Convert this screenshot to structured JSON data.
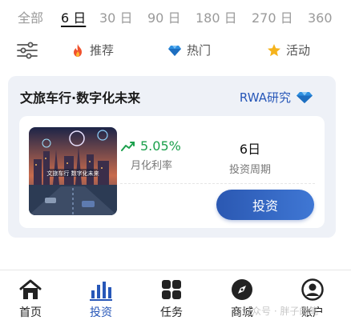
{
  "period_tabs": [
    "全部",
    "6 日",
    "30 日",
    "90 日",
    "180 日",
    "270 日",
    "360"
  ],
  "active_period_index": 1,
  "filters": [
    {
      "label": "推荐",
      "icon": "flame-icon"
    },
    {
      "label": "热门",
      "icon": "diamond-icon"
    },
    {
      "label": "活动",
      "icon": "star-icon"
    }
  ],
  "product": {
    "title": "文旅车行·数字化未来",
    "tag": "RWA研究",
    "tag_icon": "diamond-icon",
    "thumbnail_caption": "文旅车行 数字化未来",
    "rate_value": "5.05%",
    "rate_label": "月化利率",
    "period_value": "6日",
    "period_label": "投资周期",
    "invest_button": "投资"
  },
  "bottom_nav": [
    {
      "label": "首页",
      "icon": "home-icon"
    },
    {
      "label": "投资",
      "icon": "bar-chart-icon"
    },
    {
      "label": "任务",
      "icon": "grid-icon"
    },
    {
      "label": "商城",
      "icon": "compass-icon"
    },
    {
      "label": "账户",
      "icon": "user-icon"
    }
  ],
  "active_nav_index": 1,
  "watermark": "公众号 · 胖子的笔",
  "colors": {
    "accent": "#2757b8",
    "positive": "#1ba04c",
    "card_bg": "#eef1f7"
  }
}
